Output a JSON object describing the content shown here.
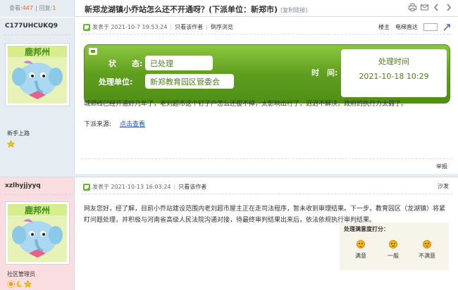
{
  "header": {
    "views_label": "查看:",
    "views": "447",
    "replies_label": "回复:",
    "replies": "1",
    "title": "新郑龙湖镇小乔站怎么还不开通呀？(下派单位：新郑市)",
    "copy_link": "[复制链接]"
  },
  "post1": {
    "username": "C177UHCUKQ9",
    "avatar_text": "鹿邦州",
    "user_title": "新手上路",
    "star_count": 1,
    "posted_at": "发表于 2021-10-7 19:53:24",
    "only_author": "只看该作者",
    "reverse": "倒序浏览",
    "floor_label": "楼主",
    "elevator": "电梯直达",
    "status": {
      "state_label": "状　　态:",
      "state_value": "已处理",
      "unit_label": "处理单位:",
      "unit_value": "新郑教育园区管委会",
      "time_label": "时　间:",
      "time_title": "处理时间",
      "time_value": "2021-10-18 10:29"
    },
    "content": "城郊线已经开通好几年了，老刘超市这个钉子户怎么还拔不掉，太影响出行了，迟迟不解决，政府的执行力太弱了。",
    "source_label": "下派来源:",
    "source_link": "点击查看",
    "report": "举报"
  },
  "post2": {
    "username": "xzlhyjjyyq",
    "avatar_text": "鹿邦州",
    "user_title": "社区管理员",
    "posted_at": "发表于 2021-10-13 16:03:24",
    "only_author": "只看该作者",
    "floor_label": "沙发",
    "content": "网友您好，经了解，目前小乔站建设范围内老刘超市屋主正在走司法程序，暂未收到审理结果。下一步，教育园区（龙湖镇）将紧盯问题处理，并积极与河南省高级人民法院沟通对接，待最终审判结果出来后，依法依规执行审判结果。",
    "rating": {
      "title": "处理满意度打分：",
      "options": [
        "满意",
        "一般",
        "不满意"
      ]
    }
  },
  "colors": {
    "accent_green": "#5f9e1f",
    "sidebar_blue": "#e5edf2",
    "sidebar_pink": "#fadde0",
    "link_blue": "#2255aa",
    "count_orange": "#e06b1a"
  }
}
